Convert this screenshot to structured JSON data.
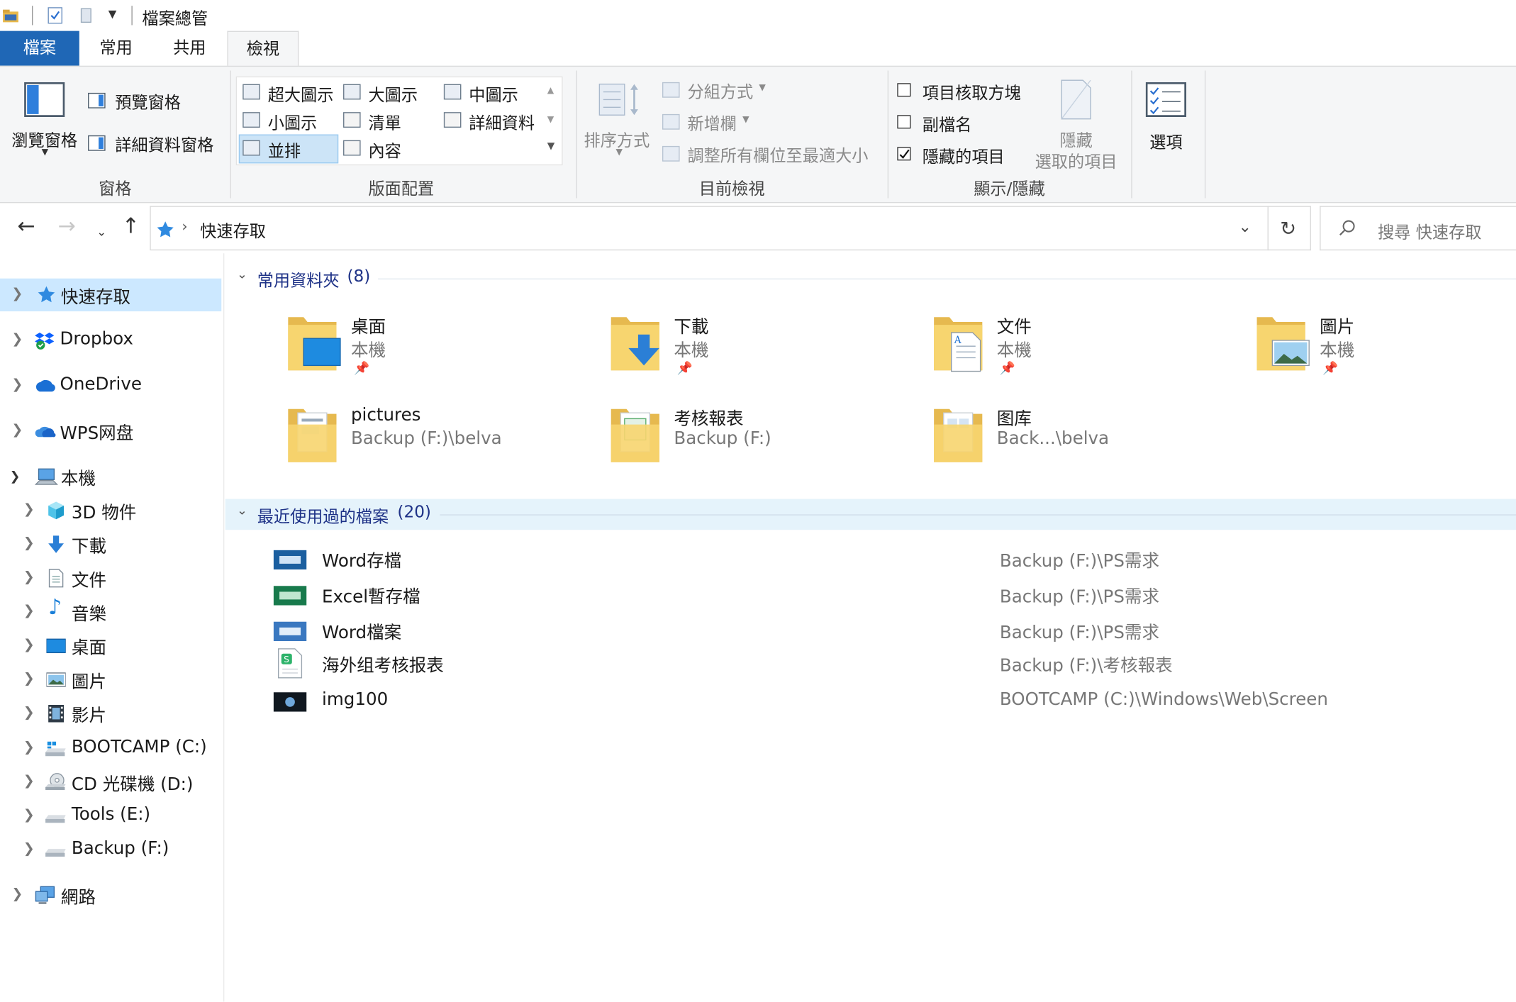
{
  "window": {
    "title": "檔案總管"
  },
  "ribbon": {
    "tabs": [
      "檔案",
      "常用",
      "共用",
      "檢視"
    ],
    "panes": {
      "navigation_pane": "瀏覽窗格",
      "preview_pane": "預覽窗格",
      "details_pane": "詳細資料窗格",
      "group_label": "窗格"
    },
    "layout": {
      "options": [
        "超大圖示",
        "大圖示",
        "中圖示",
        "小圖示",
        "清單",
        "詳細資料",
        "並排",
        "內容"
      ],
      "selected": "並排",
      "group_label": "版面配置"
    },
    "current_view": {
      "sort_by": "排序方式",
      "group_by": "分組方式",
      "add_columns": "新增欄",
      "size_all_columns": "調整所有欄位至最適大小",
      "group_label": "目前檢視"
    },
    "show_hide": {
      "item_checkboxes": {
        "label": "項目核取方塊",
        "checked": false
      },
      "file_name_extensions": {
        "label": "副檔名",
        "checked": false
      },
      "hidden_items": {
        "label": "隱藏的項目",
        "checked": true
      },
      "hide_selected_line1": "隱藏",
      "hide_selected_line2": "選取的項目",
      "group_label": "顯示/隱藏"
    },
    "options_label": "選項"
  },
  "address": {
    "path": "快速存取",
    "search_placeholder": "搜尋 快速存取"
  },
  "nav_pane": {
    "items": [
      {
        "label": "快速存取",
        "icon": "star-icon",
        "selected": true
      },
      {
        "label": "Dropbox",
        "icon": "dropbox-icon"
      },
      {
        "label": "OneDrive",
        "icon": "cloud-icon"
      },
      {
        "label": "WPS网盘",
        "icon": "cloud-icon"
      },
      {
        "label": "本機",
        "icon": "computer-icon",
        "expanded": true
      },
      {
        "label": "3D 物件",
        "icon": "cube-icon"
      },
      {
        "label": "下載",
        "icon": "download-icon"
      },
      {
        "label": "文件",
        "icon": "document-icon"
      },
      {
        "label": "音樂",
        "icon": "music-icon"
      },
      {
        "label": "桌面",
        "icon": "desktop-icon"
      },
      {
        "label": "圖片",
        "icon": "picture-icon"
      },
      {
        "label": "影片",
        "icon": "video-icon"
      },
      {
        "label": "BOOTCAMP (C:)",
        "icon": "drive-icon"
      },
      {
        "label": "CD 光碟機 (D:)",
        "icon": "cd-icon"
      },
      {
        "label": "Tools (E:)",
        "icon": "drive-icon"
      },
      {
        "label": "Backup (F:)",
        "icon": "drive-icon"
      },
      {
        "label": "網路",
        "icon": "network-icon"
      }
    ]
  },
  "content": {
    "frequent": {
      "title": "常用資料夾",
      "count": "(8)",
      "folders": [
        {
          "name": "桌面",
          "location": "本機",
          "pinned": true,
          "overlay": "desktop"
        },
        {
          "name": "下載",
          "location": "本機",
          "pinned": true,
          "overlay": "download"
        },
        {
          "name": "文件",
          "location": "本機",
          "pinned": true,
          "overlay": "document"
        },
        {
          "name": "圖片",
          "location": "本機",
          "pinned": true,
          "overlay": "picture"
        },
        {
          "name": "pictures",
          "location": "Backup (F:)\\belva",
          "pinned": false,
          "overlay": "papers"
        },
        {
          "name": "考核報表",
          "location": "Backup (F:)",
          "pinned": false,
          "overlay": "papers"
        },
        {
          "name": "图库",
          "location": "Back...\\belva",
          "pinned": false,
          "overlay": "papers"
        }
      ]
    },
    "recent": {
      "title": "最近使用過的檔案",
      "count": "(20)",
      "files": [
        {
          "name": "Word存檔",
          "path": "Backup (F:)\\PS需求",
          "thumb": "#1b5fa0"
        },
        {
          "name": "Excel暫存檔",
          "path": "Backup (F:)\\PS需求",
          "thumb": "#187a4c"
        },
        {
          "name": "Word檔案",
          "path": "Backup (F:)\\PS需求",
          "thumb": "#3a78c0"
        },
        {
          "name": "海外组考核报表",
          "path": "Backup (F:)\\考核報表",
          "thumb": "#ffffff"
        },
        {
          "name": "img100",
          "path": "BOOTCAMP (C:)\\Windows\\Web\\Screen",
          "thumb": "#101820"
        }
      ]
    }
  },
  "colors": {
    "accent": "#1f67b6",
    "selection": "#cce8ff",
    "section_heading": "#1e3287"
  }
}
